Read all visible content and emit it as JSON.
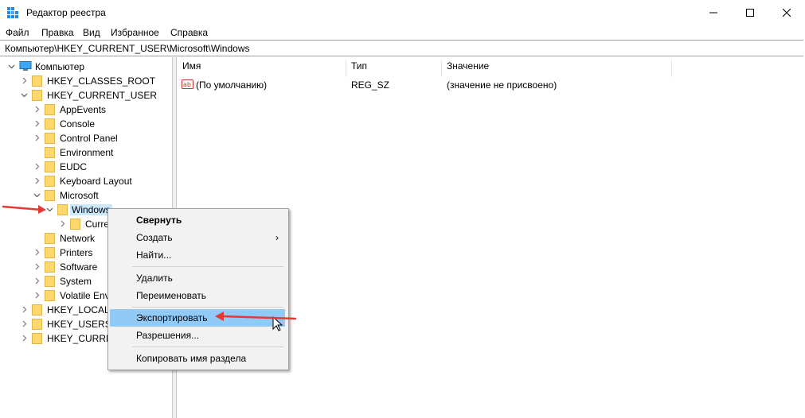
{
  "window": {
    "title": "Редактор реестра",
    "icon": "registry-editor-icon",
    "controls": [
      "minimize-icon",
      "maximize-icon",
      "close-icon"
    ]
  },
  "menu": [
    "Файл",
    "Правка",
    "Вид",
    "Избранное",
    "Справка"
  ],
  "address": "Компьютер\\HKEY_CURRENT_USER\\Microsoft\\Windows",
  "tree": {
    "root": "Компьютер",
    "hkcr": "HKEY_CLASSES_ROOT",
    "hkcu": "HKEY_CURRENT_USER",
    "hkcu_children": [
      "AppEvents",
      "Console",
      "Control Panel",
      "Environment",
      "EUDC",
      "Keyboard Layout",
      "Microsoft"
    ],
    "selected": "Windows",
    "windows_child": "Curre",
    "after": [
      "Network",
      "Printers",
      "Software",
      "System",
      "Volatile Env"
    ],
    "hklm": "HKEY_LOCAL_",
    "hku": "HKEY_USERS",
    "hkcc": "HKEY_CURREN"
  },
  "list": {
    "headers": {
      "name": "Имя",
      "type": "Тип",
      "value": "Значение"
    },
    "rows": [
      {
        "name": "(По умолчанию)",
        "type": "REG_SZ",
        "value": "(значение не присвоено)"
      }
    ]
  },
  "context_menu": {
    "items": {
      "collapse": "Свернуть",
      "create": "Создать",
      "find": "Найти...",
      "delete": "Удалить",
      "rename": "Переименовать",
      "export": "Экспортировать",
      "permissions": "Разрешения...",
      "copy_key": "Копировать имя раздела"
    },
    "submenu_arrow": "›",
    "highlighted": "export"
  },
  "colors": {
    "selection": "#cce8ff",
    "menu_highlight": "#91c9f7",
    "folder": "#ffd86b",
    "annotation_arrow": "#e53935"
  }
}
